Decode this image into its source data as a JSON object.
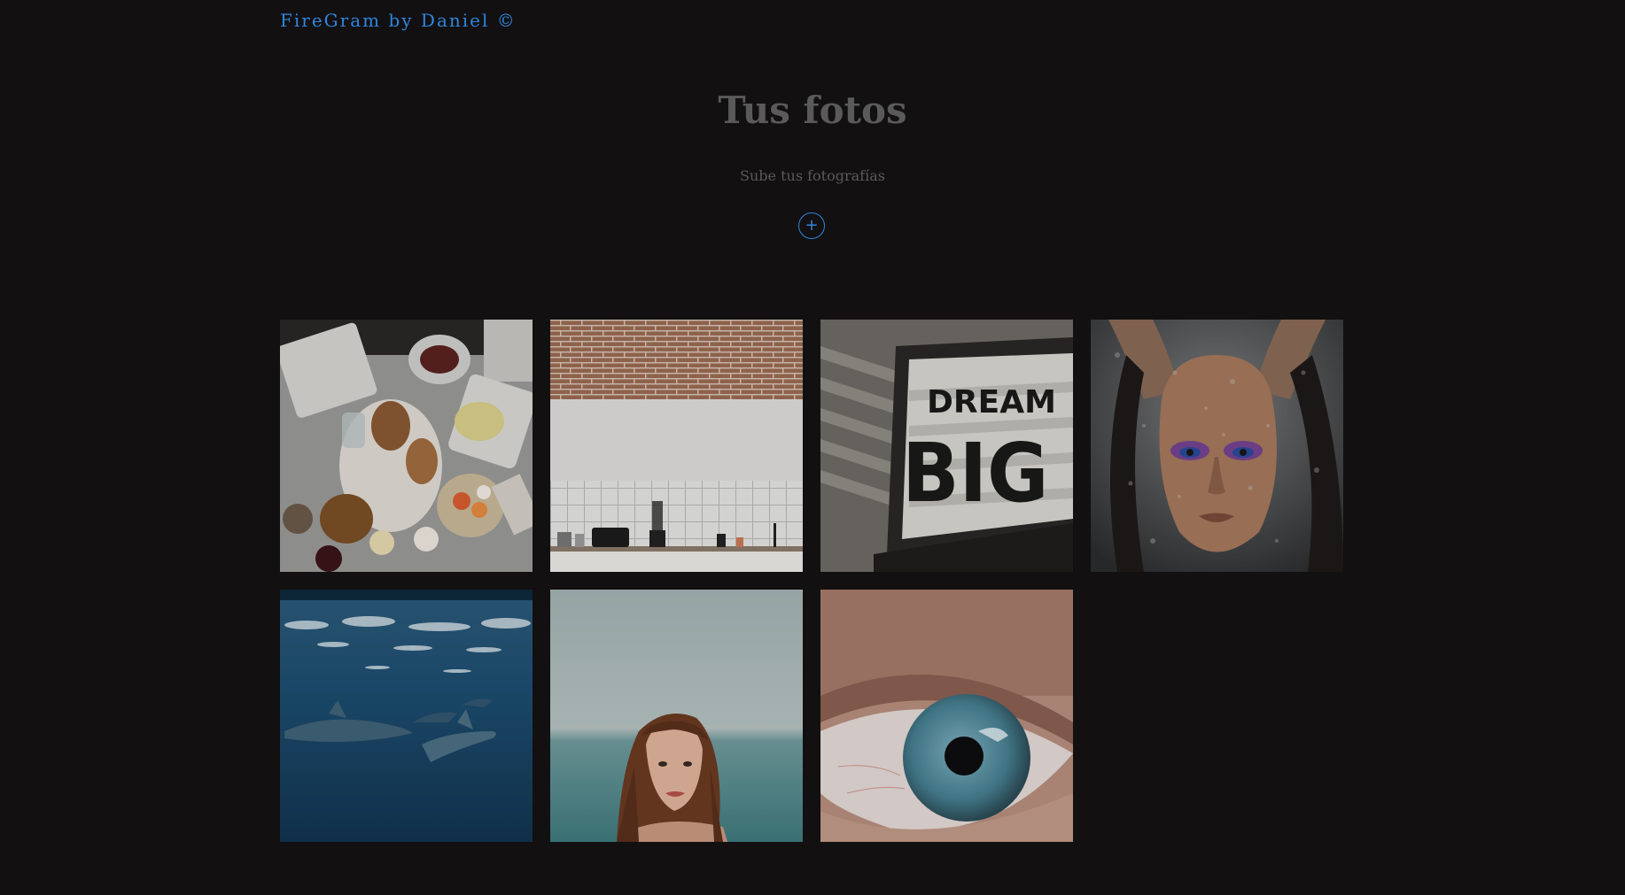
{
  "header": {
    "app_title": "FireGram by Daniel ©"
  },
  "main": {
    "title": "Tus fotos",
    "subtitle": "Sube tus fotografías",
    "upload_button_label": "+"
  },
  "gallery": {
    "photos": [
      {
        "name": "photo-breakfast-table",
        "description": "food on table",
        "sign_text": ""
      },
      {
        "name": "photo-white-kitchen",
        "description": "white kitchen with brick wall",
        "sign_text": ""
      },
      {
        "name": "photo-dream-big-sign",
        "description": "framed sign",
        "sign_text": "DREAM BIG"
      },
      {
        "name": "photo-woman-behind-wet-glass",
        "description": "woman behind wet glass",
        "sign_text": ""
      },
      {
        "name": "photo-dolphins-underwater",
        "description": "dolphins underwater",
        "sign_text": ""
      },
      {
        "name": "photo-woman-in-sea",
        "description": "woman in sea",
        "sign_text": ""
      },
      {
        "name": "photo-eye-closeup",
        "description": "eye closeup",
        "sign_text": ""
      }
    ]
  },
  "colors": {
    "background": "#121011",
    "accent": "#2f86dd",
    "muted_text": "#5b5a5b"
  }
}
